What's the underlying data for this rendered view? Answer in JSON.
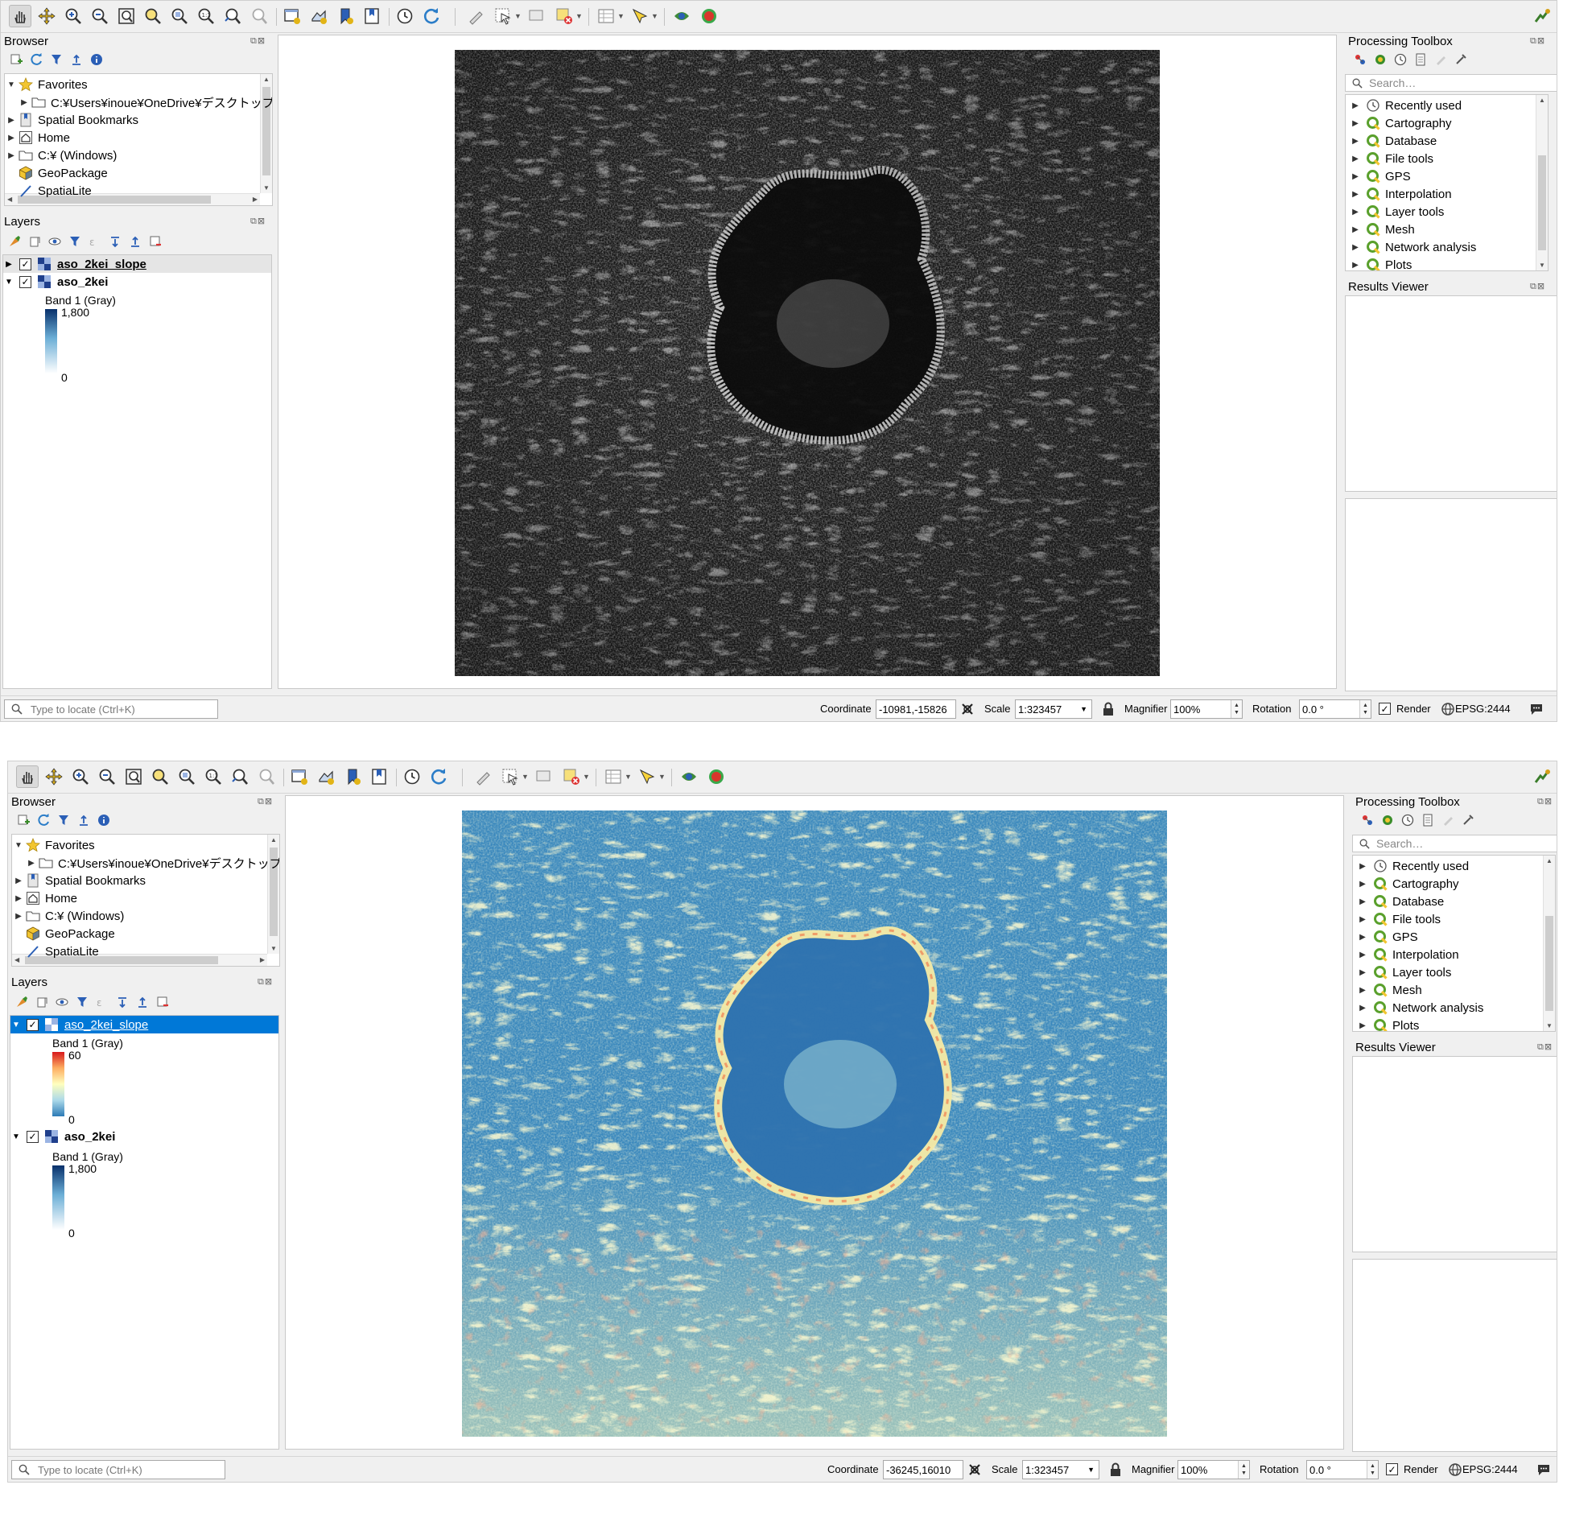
{
  "window1": {
    "toolbar": {
      "icons": [
        "pan-icon",
        "pan-to-selection-icon",
        "zoom-in-icon",
        "zoom-out-icon",
        "zoom-full-icon",
        "zoom-to-selection-icon",
        "zoom-to-layer-icon",
        "zoom-native-icon",
        "zoom-last-icon",
        "zoom-next-icon",
        "new-map-view-icon",
        "new-3d-view-icon",
        "new-bookmark-icon",
        "show-bookmarks-icon",
        "temporal-controller-icon",
        "refresh-icon"
      ],
      "edit_icons": [
        "identify-icon",
        "select-features-icon",
        "select-value-icon",
        "deselect-icon",
        "attribute-table-icon",
        "statistics-icon",
        "plugin-icon",
        "python-icon"
      ]
    },
    "browser": {
      "title": "Browser",
      "items": [
        {
          "label": "Favorites",
          "icon": "star-icon",
          "expanded": true,
          "indent": 0
        },
        {
          "label": "C:¥Users¥inoue¥OneDrive¥デスクトップ",
          "icon": "folder-icon",
          "expanded": false,
          "indent": 1
        },
        {
          "label": "Spatial Bookmarks",
          "icon": "bookmarks-icon",
          "expanded": false,
          "indent": 0
        },
        {
          "label": "Home",
          "icon": "home-icon",
          "expanded": false,
          "indent": 0
        },
        {
          "label": "C:¥ (Windows)",
          "icon": "folder-icon",
          "expanded": false,
          "indent": 0
        },
        {
          "label": "GeoPackage",
          "icon": "geopackage-icon",
          "expanded": null,
          "indent": 0
        },
        {
          "label": "SpatiaLite",
          "icon": "spatialite-icon",
          "expanded": null,
          "indent": 0
        }
      ]
    },
    "layers": {
      "title": "Layers",
      "items": [
        {
          "name": "aso_2kei_slope",
          "checked": true,
          "expanded": false
        },
        {
          "name": "aso_2kei",
          "checked": true,
          "expanded": true,
          "band": "Band 1 (Gray)",
          "max": "1,800",
          "min": "0"
        }
      ]
    },
    "toolbox": {
      "title": "Processing Toolbox",
      "search_placeholder": "Search…",
      "items": [
        "Recently used",
        "Cartography",
        "Database",
        "File tools",
        "GPS",
        "Interpolation",
        "Layer tools",
        "Mesh",
        "Network analysis",
        "Plots"
      ]
    },
    "results_viewer": {
      "title": "Results Viewer"
    },
    "status": {
      "locate_placeholder": "Type to locate (Ctrl+K)",
      "coordinate_label": "Coordinate",
      "coordinate": "-10981,-15826",
      "scale_label": "Scale",
      "scale": "1:323457",
      "magnifier_label": "Magnifier",
      "magnifier": "100%",
      "rotation_label": "Rotation",
      "rotation": "0.0 °",
      "render_label": "Render",
      "crs": "EPSG:2444"
    }
  },
  "window2": {
    "browser": {
      "title": "Browser",
      "items": [
        {
          "label": "Favorites",
          "icon": "star-icon",
          "expanded": true,
          "indent": 0
        },
        {
          "label": "C:¥Users¥inoue¥OneDrive¥デスクトップ",
          "icon": "folder-icon",
          "expanded": false,
          "indent": 1
        },
        {
          "label": "Spatial Bookmarks",
          "icon": "bookmarks-icon",
          "expanded": false,
          "indent": 0
        },
        {
          "label": "Home",
          "icon": "home-icon",
          "expanded": false,
          "indent": 0
        },
        {
          "label": "C:¥ (Windows)",
          "icon": "folder-icon",
          "expanded": false,
          "indent": 0
        },
        {
          "label": "GeoPackage",
          "icon": "geopackage-icon",
          "expanded": null,
          "indent": 0
        },
        {
          "label": "SpatiaLite",
          "icon": "spatialite-icon",
          "expanded": null,
          "indent": 0
        }
      ]
    },
    "layers": {
      "title": "Layers",
      "items": [
        {
          "name": "aso_2kei_slope",
          "checked": true,
          "expanded": true,
          "selected": true,
          "band": "Band 1 (Gray)",
          "max": "60",
          "min": "0"
        },
        {
          "name": "aso_2kei",
          "checked": true,
          "expanded": true,
          "band": "Band 1 (Gray)",
          "max": "1,800",
          "min": "0"
        }
      ]
    },
    "toolbox": {
      "title": "Processing Toolbox",
      "search_placeholder": "Search…",
      "items": [
        "Recently used",
        "Cartography",
        "Database",
        "File tools",
        "GPS",
        "Interpolation",
        "Layer tools",
        "Mesh",
        "Network analysis",
        "Plots"
      ]
    },
    "results_viewer": {
      "title": "Results Viewer"
    },
    "status": {
      "locate_placeholder": "Type to locate (Ctrl+K)",
      "coordinate_label": "Coordinate",
      "coordinate": "-36245,16010",
      "scale_label": "Scale",
      "scale": "1:323457",
      "magnifier_label": "Magnifier",
      "magnifier": "100%",
      "rotation_label": "Rotation",
      "rotation": "0.0 °",
      "render_label": "Render",
      "crs": "EPSG:2444"
    }
  },
  "colors": {
    "selection": "#0078d7",
    "grayscale_ramp": [
      "#08306b",
      "#ffffff"
    ],
    "slope_ramp": [
      "#d7191c",
      "#fdae61",
      "#ffffbf",
      "#abd9e9",
      "#2c7bb6"
    ]
  }
}
